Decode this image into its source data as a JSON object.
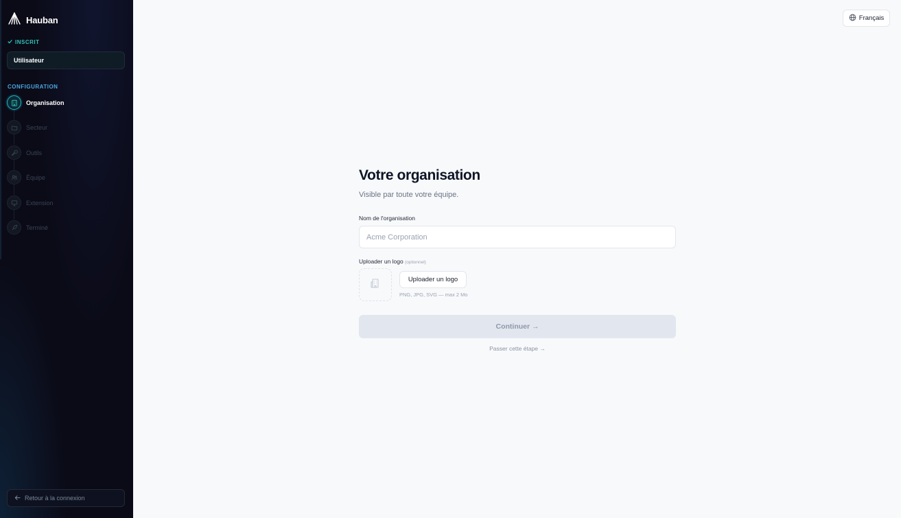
{
  "app": {
    "name": "Hauban"
  },
  "sidebar": {
    "inscrit_label": "INSCRIT",
    "user_step": "Utilisateur",
    "config_label": "CONFIGURATION",
    "steps": [
      {
        "label": "Organisation",
        "icon": "building-icon",
        "state": "active"
      },
      {
        "label": "Secteur",
        "icon": "folder-icon",
        "state": "pending"
      },
      {
        "label": "Outils",
        "icon": "wrench-icon",
        "state": "pending"
      },
      {
        "label": "Équipe",
        "icon": "users-icon",
        "state": "pending"
      },
      {
        "label": "Extension",
        "icon": "monitor-icon",
        "state": "pending"
      },
      {
        "label": "Terminé",
        "icon": "rocket-icon",
        "state": "pending"
      }
    ],
    "back_label": "Retour à la connexion"
  },
  "language": {
    "label": "Français"
  },
  "form": {
    "title": "Votre organisation",
    "subtitle": "Visible par toute votre équipe.",
    "org_label": "Nom de l'organisation",
    "org_placeholder": "Acme Corporation",
    "org_value": "",
    "logo_label": "Uploader un logo",
    "logo_optional": "(optionnel)",
    "upload_button": "Uploader un logo",
    "upload_hint": "PNG, JPG, SVG — max 2 Mo",
    "continue_button": "Continuer →",
    "skip_link": "Passer cette étape →"
  },
  "colors": {
    "accent_teal": "#2ec4b6",
    "accent_blue": "#4aa8e0",
    "active_ring": "#22b5c7",
    "sidebar_bg": "#0b0b18",
    "main_bg": "#f8f9fb"
  }
}
